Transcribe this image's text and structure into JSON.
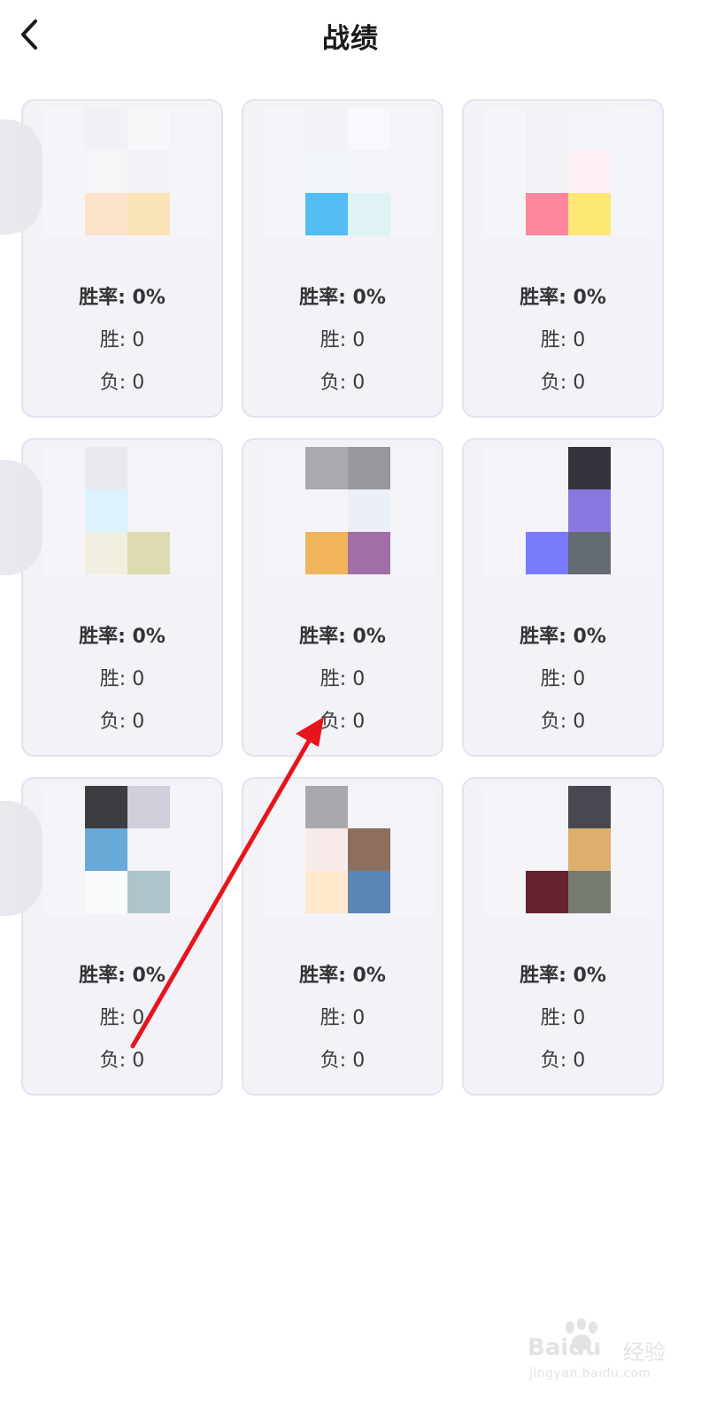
{
  "header": {
    "title": "战绩",
    "back_icon": "chevron-left-icon"
  },
  "cards": [
    {
      "rate_label": "胜率: 0%",
      "wins_label": "胜: 0",
      "losses_label": "负: 0",
      "avatar_colors": [
        "#f0f0f5",
        "#f8f8fb",
        "#f4f6f8",
        "#f3f3f7",
        "#fde3c9",
        "#fbe3b8"
      ]
    },
    {
      "rate_label": "胜率: 0%",
      "wins_label": "胜: 0",
      "losses_label": "负: 0",
      "avatar_colors": [
        "#f3f3f7",
        "#f8f9fc",
        "#f1f4f8",
        "#f2f4f8",
        "#52bdf3",
        "#dff2f4"
      ]
    },
    {
      "rate_label": "胜率: 0%",
      "wins_label": "胜: 0",
      "losses_label": "负: 0",
      "avatar_colors": [
        "#f2f2f6",
        "#f3f3f8",
        "#f2f2f6",
        "#fdf0f4",
        "#fd879c",
        "#fde775"
      ]
    },
    {
      "rate_label": "胜率: 0%",
      "wins_label": "胜: 0",
      "losses_label": "负: 0",
      "avatar_colors": [
        "#e9e9f0",
        "#f3f3f8",
        "#dcf2fc",
        "#f3f3f8",
        "#f1efdf",
        "#dcdcb0"
      ]
    },
    {
      "rate_label": "胜率: 0%",
      "wins_label": "胜: 0",
      "losses_label": "负: 0",
      "avatar_colors": [
        "#a9a9b0",
        "#97979e",
        "#f5f5f9",
        "#eaeff8",
        "#efb45c",
        "#a16fa5"
      ]
    },
    {
      "rate_label": "胜率: 0%",
      "wins_label": "胜: 0",
      "losses_label": "负: 0",
      "avatar_colors": [
        "#f3f3f8",
        "#33333b",
        "#f3f3f8",
        "#8a78e0",
        "#7a7bfc",
        "#656b72"
      ]
    },
    {
      "rate_label": "胜率: 0%",
      "wins_label": "胜: 0",
      "losses_label": "负: 0",
      "avatar_colors": [
        "#3c3c42",
        "#d0d0da",
        "#69a9d8",
        "#f3f3f8",
        "#f8fbf8",
        "#afc4c9"
      ]
    },
    {
      "rate_label": "胜率: 0%",
      "wins_label": "胜: 0",
      "losses_label": "负: 0",
      "avatar_colors": [
        "#a8a8ad",
        "#f3f3f8",
        "#f7ece9",
        "#8c6f5d",
        "#ffe8cc",
        "#5986b3"
      ]
    },
    {
      "rate_label": "胜率: 0%",
      "wins_label": "胜: 0",
      "losses_label": "负: 0",
      "avatar_colors": [
        "#f3f3f8",
        "#484850",
        "#f3f3f8",
        "#dcb06c",
        "#65222f",
        "#777c70"
      ]
    }
  ],
  "annotation": {
    "arrow_color": "#e8141b"
  },
  "watermark": {
    "brand": "Baidu",
    "brand_cn": "经验",
    "url": "jingyan.baidu.com"
  }
}
